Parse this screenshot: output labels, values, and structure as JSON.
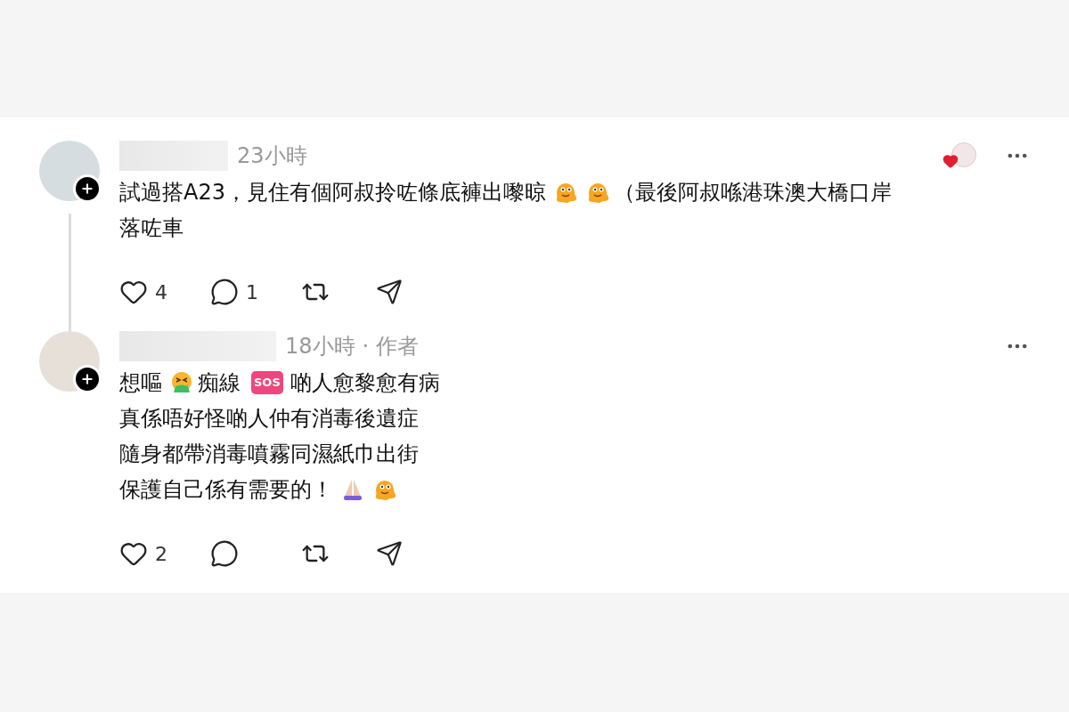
{
  "comments": [
    {
      "time": "23小時",
      "reactions": true,
      "thread_line": true,
      "lines": [
        [
          {
            "kind": "text",
            "text": "試過搭A23，見住有個阿叔拎咗條底褲出嚟晾"
          },
          {
            "kind": "melting"
          },
          {
            "kind": "melting"
          },
          {
            "kind": "text",
            "text": "（最後阿叔喺港珠澳大橋口岸"
          }
        ],
        [
          {
            "kind": "text",
            "text": "落咗車"
          }
        ]
      ],
      "likes": "4",
      "replies": "1"
    },
    {
      "time": "18小時",
      "separator": "·",
      "author_tag": "作者",
      "reactions": false,
      "thread_line": false,
      "lines": [
        [
          {
            "kind": "text",
            "text": "想嘔"
          },
          {
            "kind": "vomiting"
          },
          {
            "kind": "text",
            "text": "痴線"
          },
          {
            "kind": "badge",
            "text": "SOS"
          },
          {
            "kind": "text",
            "text": "啲人愈黎愈有病"
          }
        ],
        [
          {
            "kind": "text",
            "text": "真係唔好怪啲人仲有消毒後遺症"
          }
        ],
        [
          {
            "kind": "text",
            "text": "隨身都帶消毒噴霧同濕紙巾出街"
          }
        ],
        [
          {
            "kind": "text",
            "text": "保護自己係有需要的！"
          },
          {
            "kind": "praying"
          },
          {
            "kind": "melting"
          }
        ]
      ],
      "likes": "2"
    }
  ]
}
